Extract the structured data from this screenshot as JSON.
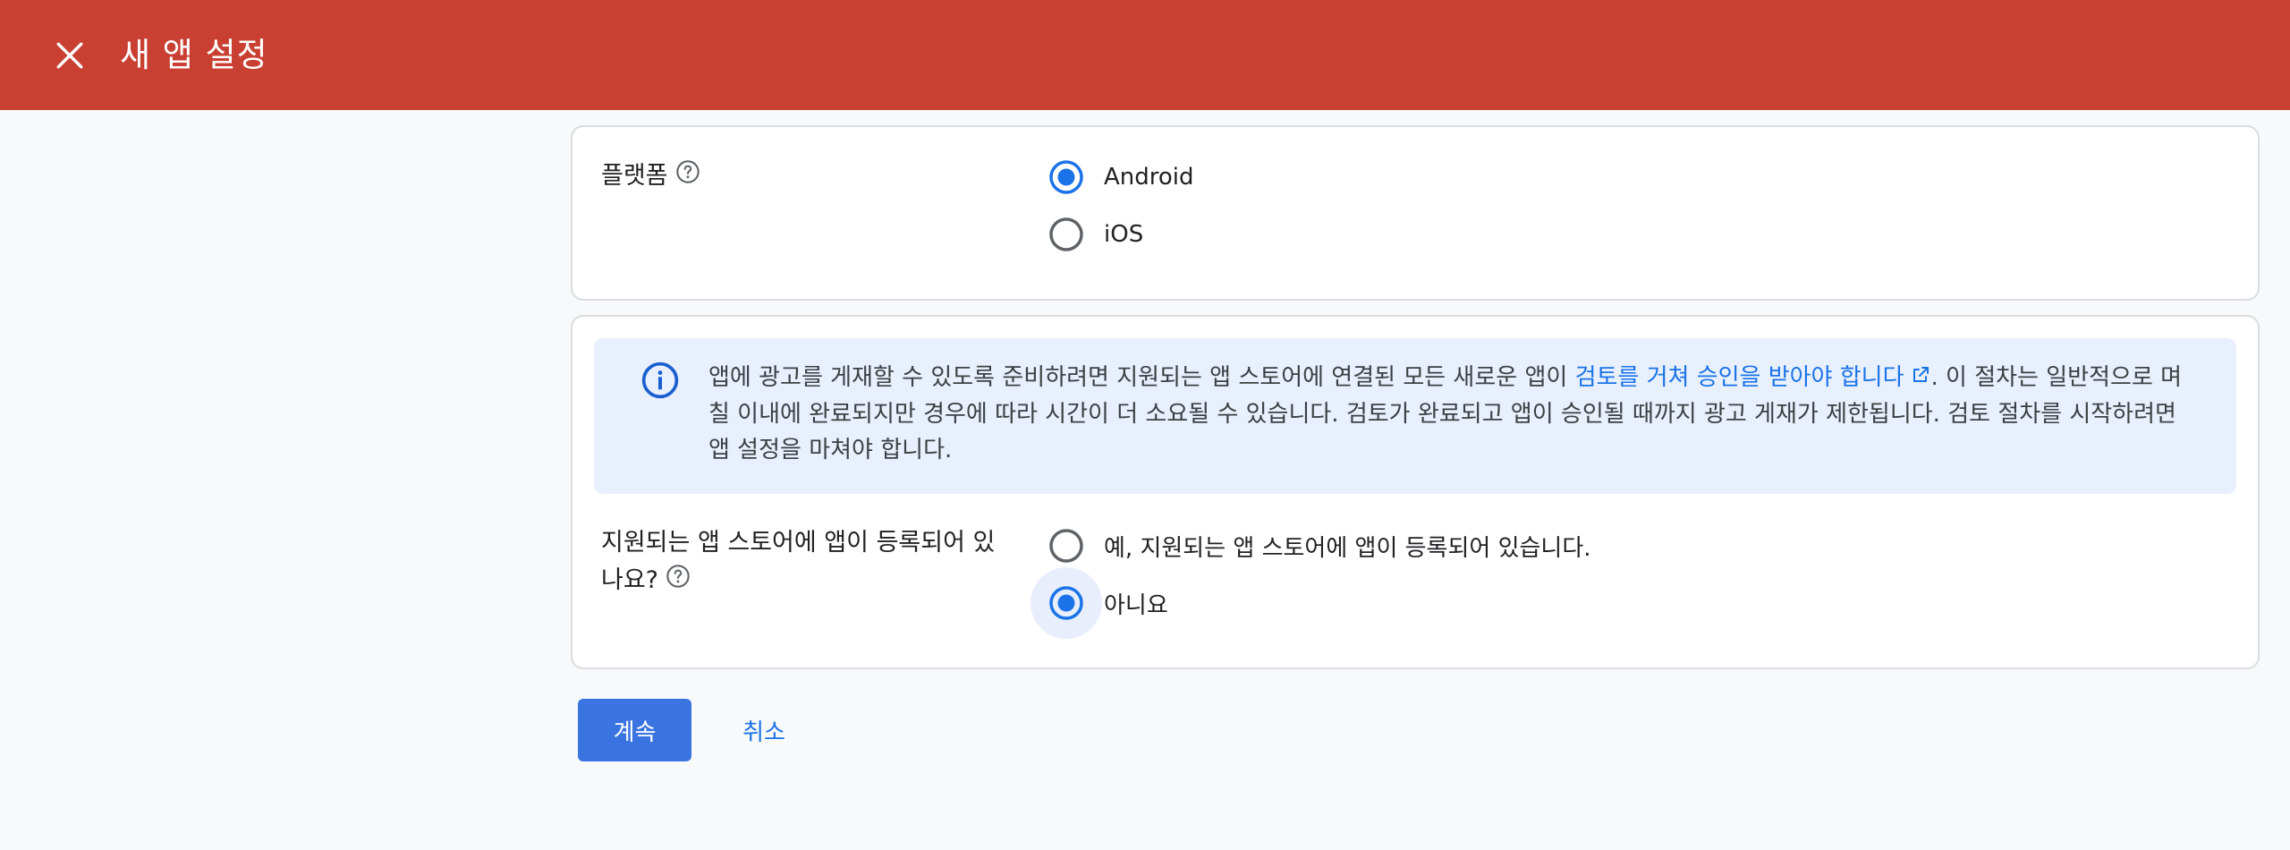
{
  "header": {
    "title": "새 앱 설정",
    "close_icon": "close-icon",
    "background_color": "#c94032"
  },
  "platform": {
    "label": "플랫폼",
    "help_icon": "help-circle-icon",
    "options": [
      {
        "label": "Android",
        "selected": true
      },
      {
        "label": "iOS",
        "selected": false
      }
    ]
  },
  "notice": {
    "icon": "info-icon",
    "text_before": "앱에 광고를 게재할 수 있도록 준비하려면 지원되는 앱 스토어에 연결된 모든 새로운 앱이 ",
    "link_text": "검토를 거쳐 승인을 받아야 합니다",
    "link_icon": "external-link-icon",
    "text_after": ". 이 절차는 일반적으로 며칠 이내에 완료되지만 경우에 따라 시간이 더 소요될 수 있습니다. 검토가 완료되고 앱이 승인될 때까지 광고 게재가 제한됩니다. 검토 절차를 시작하려면 앱 설정을 마쳐야 합니다.",
    "background_color": "#e8f0fe"
  },
  "store_listed": {
    "label_line1": "지원되는 앱 스토어에 앱이 등록되어 있",
    "label_line2": "나요?",
    "help_icon": "help-circle-icon",
    "options": [
      {
        "label": "예, 지원되는 앱 스토어에 앱이 등록되어 있습니다.",
        "selected": false
      },
      {
        "label": "아니요",
        "selected": true
      }
    ]
  },
  "actions": {
    "continue_label": "계속",
    "cancel_label": "취소",
    "accent_color": "#3a74e0"
  }
}
